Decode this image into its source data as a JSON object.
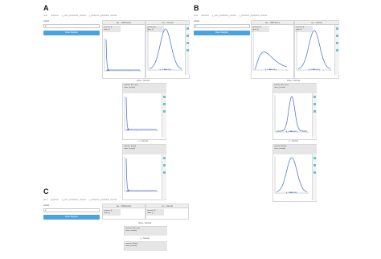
{
  "panels": {
    "a": {
      "letter": "A"
    },
    "b": {
      "letter": "B"
    },
    "c": {
      "letter": "C"
    }
  },
  "tabs": [
    "prior",
    "posterior",
    "y_prior_predictive_checks",
    "y_posterior_predictive_checks"
  ],
  "sidebar": {
    "select_label": "school",
    "select_value": "A",
    "button_label": "Reset Diagram"
  },
  "cards": {
    "tau": {
      "title": "tau ~ HalfCauchy"
    },
    "mu": {
      "title": "mu ~ Normal"
    },
    "theta": {
      "caption": "theta ~ Normal",
      "info": [
        "parents: [tau, mu]",
        "dims: [school]"
      ]
    },
    "y": {
      "caption": "y ~ Normal",
      "info": [
        "parents: [theta]",
        "dims: [school]"
      ]
    },
    "tau_info": [
      "parents: []",
      "dims: []"
    ],
    "mu_info": [
      "parents: []",
      "dims: []"
    ]
  },
  "colors": {
    "curve": "#5a7bd8",
    "button": "#4aa3df",
    "tool": "#6cc3c7"
  },
  "icons": [
    "zoom-tool-icon",
    "pan-tool-icon",
    "reset-tool-icon",
    "save-tool-icon"
  ]
}
